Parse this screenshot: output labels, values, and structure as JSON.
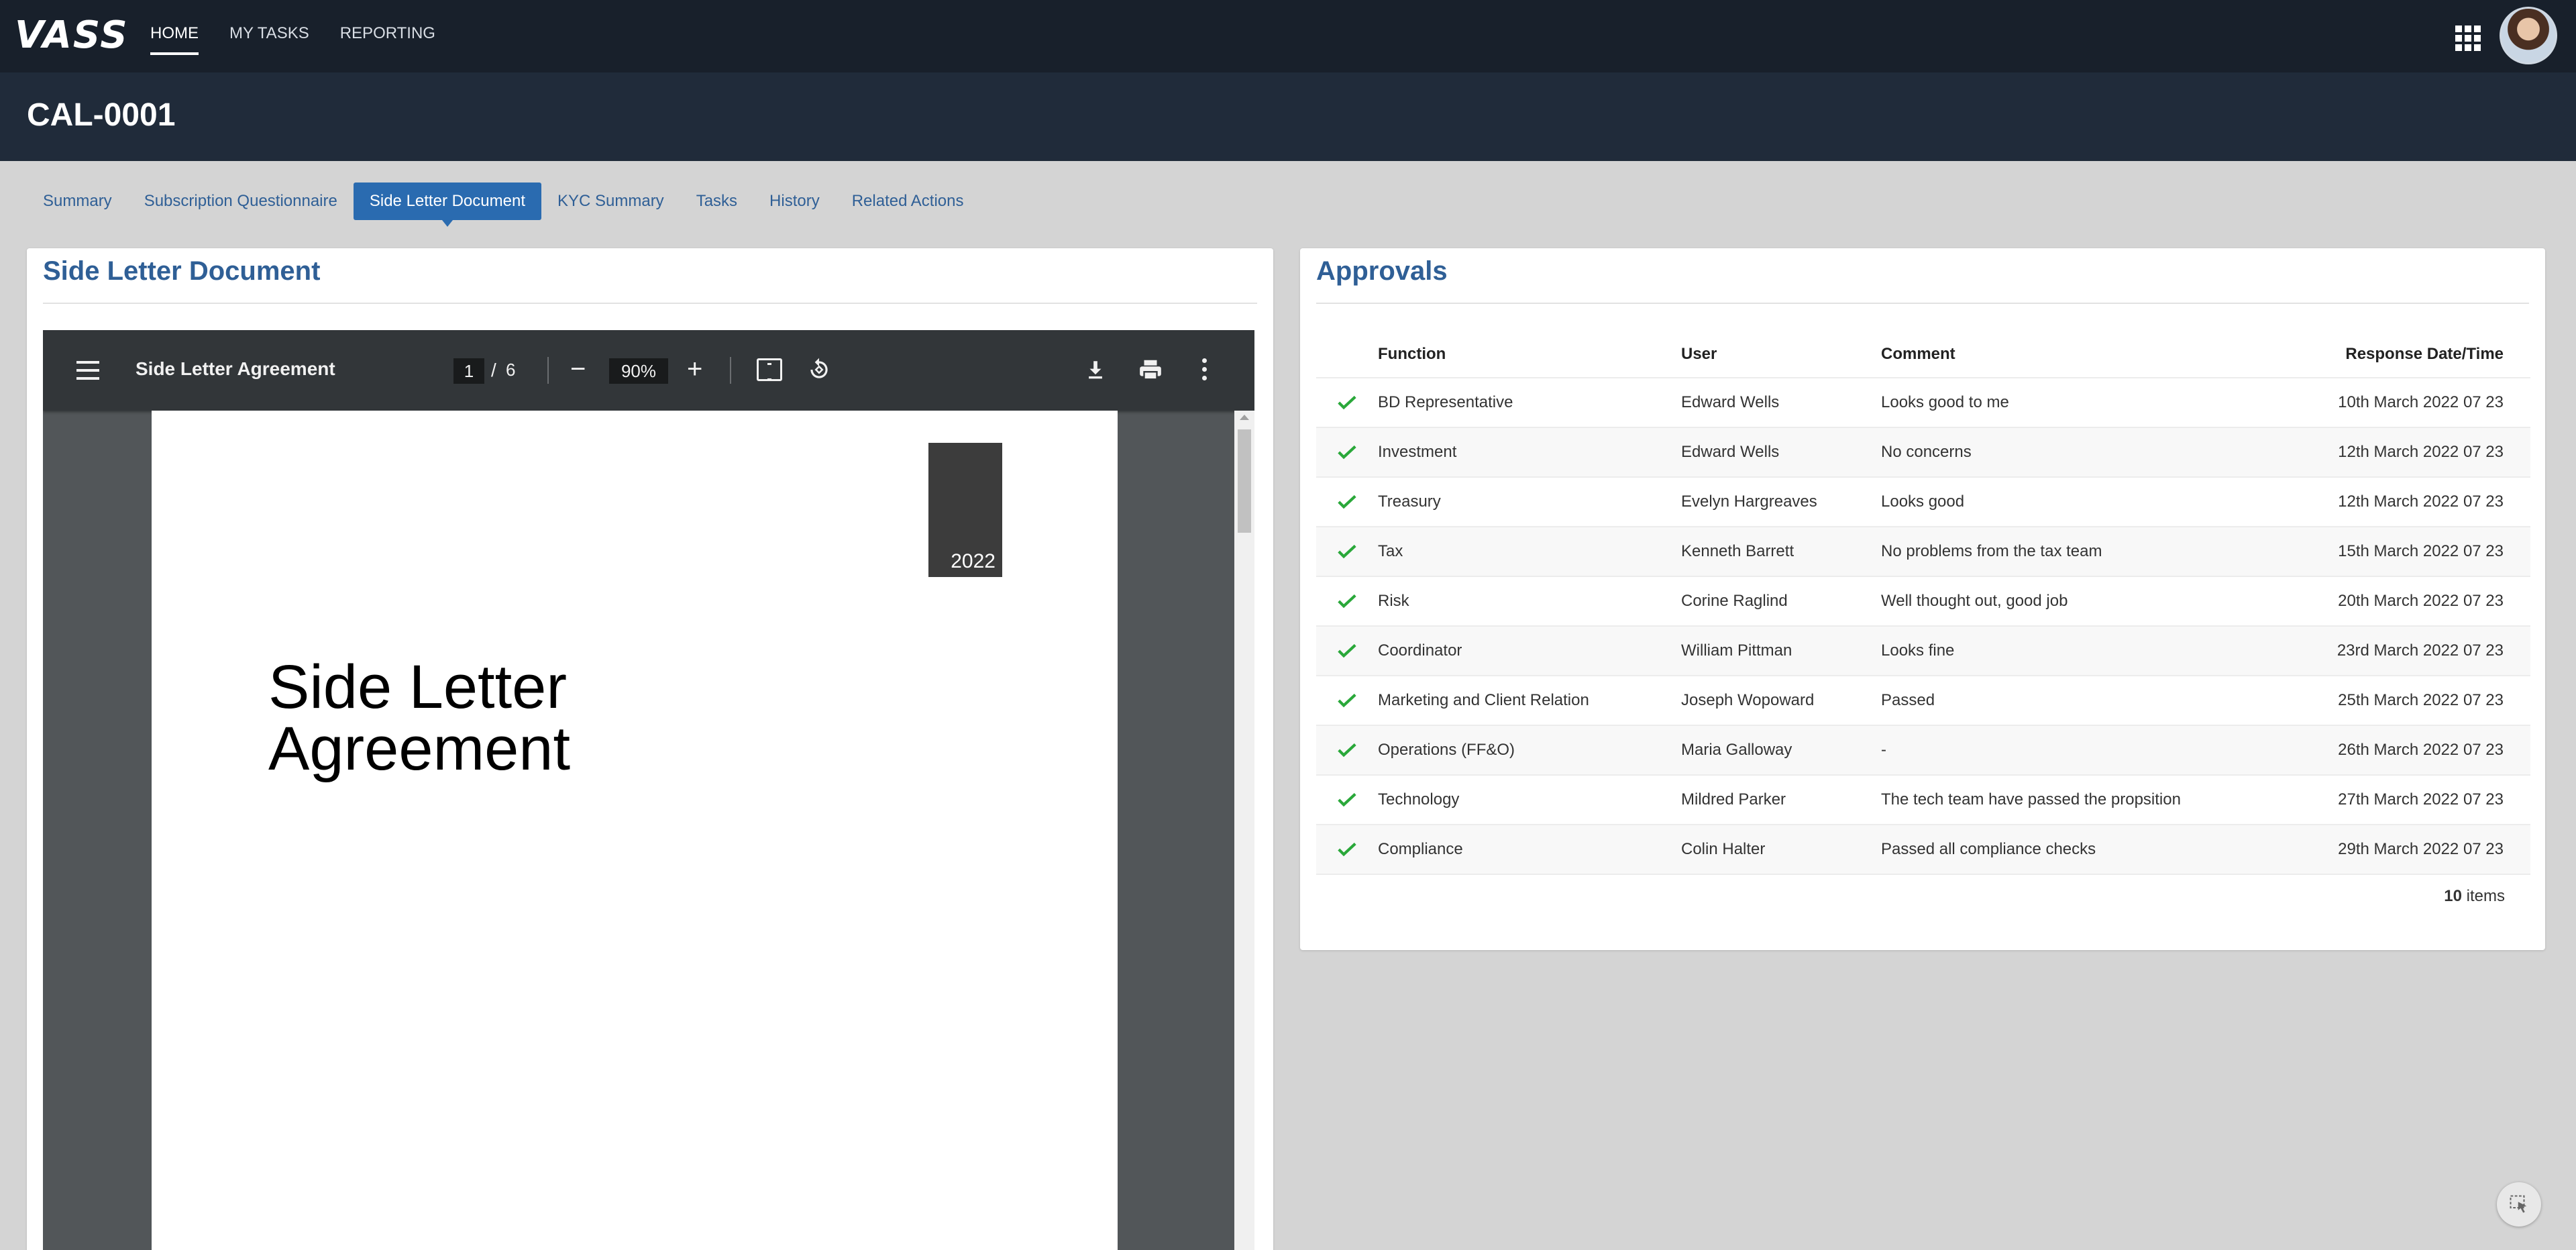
{
  "app": {
    "logo": "VASS"
  },
  "nav": {
    "items": [
      "HOME",
      "MY TASKS",
      "REPORTING"
    ],
    "active": "HOME"
  },
  "case": {
    "title": "CAL-0001"
  },
  "tabs": [
    "Summary",
    "Subscription Questionnaire",
    "Side Letter Document",
    "KYC Summary",
    "Tasks",
    "History",
    "Related Actions"
  ],
  "active_tab": "Side Letter Document",
  "left_panel": {
    "title": "Side Letter Document",
    "viewer": {
      "doc_name": "Side Letter Agreement",
      "page_current": "1",
      "page_sep": "/",
      "page_total": "6",
      "zoom": "90%",
      "zoom_minus": "−",
      "zoom_plus": "+",
      "page_year": "2022",
      "page_title_line1": "Side Letter",
      "page_title_line2": "Agreement"
    }
  },
  "right_panel": {
    "title": "Approvals",
    "columns": [
      "Function",
      "User",
      "Comment",
      "Response Date/Time"
    ],
    "rows": [
      {
        "function": "BD Representative",
        "user": "Edward Wells",
        "comment": "Looks good to me",
        "date": "10th March 2022 07 23"
      },
      {
        "function": "Investment",
        "user": "Edward Wells",
        "comment": "No concerns",
        "date": "12th March 2022 07 23"
      },
      {
        "function": "Treasury",
        "user": "Evelyn Hargreaves",
        "comment": "Looks good",
        "date": "12th March 2022 07 23"
      },
      {
        "function": "Tax",
        "user": "Kenneth Barrett",
        "comment": "No problems from the tax team",
        "date": "15th March 2022 07 23"
      },
      {
        "function": "Risk",
        "user": "Corine Raglind",
        "comment": "Well thought out, good job",
        "date": "20th March 2022 07 23"
      },
      {
        "function": "Coordinator",
        "user": "William Pittman",
        "comment": "Looks fine",
        "date": "23rd March 2022 07 23"
      },
      {
        "function": "Marketing and Client Relation",
        "user": "Joseph Wopoward",
        "comment": "Passed",
        "date": "25th March 2022 07 23"
      },
      {
        "function": "Operations (FF&O)",
        "user": "Maria Galloway",
        "comment": "-",
        "date": "26th March 2022 07 23"
      },
      {
        "function": "Technology",
        "user": "Mildred Parker",
        "comment": "The tech team have passed the propsition",
        "date": "27th March 2022 07 23"
      },
      {
        "function": "Compliance",
        "user": "Colin Halter",
        "comment": "Passed all compliance checks",
        "date": "29th March 2022 07 23"
      }
    ],
    "items_count": "10",
    "items_label": " items"
  },
  "colors": {
    "nav_bg": "#18202b",
    "title_bg": "#202b3a",
    "accent": "#2a6bb0",
    "check": "#2aa83a"
  },
  "icons": [
    "apps-grid-icon",
    "menu-icon",
    "fit-page-icon",
    "rotate-icon",
    "download-icon",
    "print-icon",
    "more-vert-icon",
    "check-icon",
    "select-cursor-icon"
  ]
}
